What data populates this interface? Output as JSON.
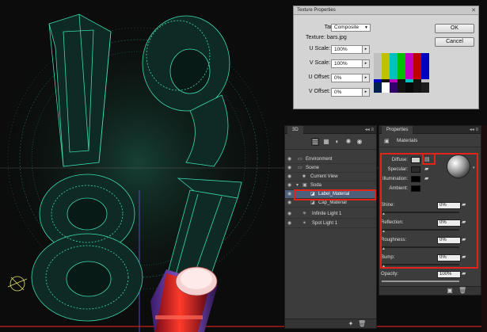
{
  "texture_dialog": {
    "title": "Texture Properties",
    "target_label": "Target:",
    "target_value": "Composite",
    "texture_label": "Texture: bars.jpg",
    "u_scale_label": "U Scale:",
    "u_scale_value": "100%",
    "v_scale_label": "V Scale:",
    "v_scale_value": "100%",
    "u_offset_label": "U Offset:",
    "u_offset_value": "0%",
    "v_offset_label": "V Offset:",
    "v_offset_value": "0%",
    "ok_label": "OK",
    "cancel_label": "Cancel",
    "bar_colors_top": [
      "#c0c0c0",
      "#c0c000",
      "#00c0c0",
      "#00c000",
      "#c000c0",
      "#c00000",
      "#0000c0"
    ],
    "bar_colors_mid": [
      "#0000c0",
      "#131313",
      "#c000c0",
      "#131313",
      "#00c0c0",
      "#131313",
      "#c0c0c0"
    ],
    "bar_colors_bottom": [
      "#00214c",
      "#ffffff",
      "#32006a",
      "#131313",
      "#090909",
      "#131313",
      "#1d1d1d"
    ]
  },
  "panel_3d": {
    "tab": "3D",
    "layers": [
      {
        "label": "Environment"
      },
      {
        "label": "Scene"
      },
      {
        "label": "Current View"
      },
      {
        "label": "Soda"
      },
      {
        "label": "Label_Material"
      },
      {
        "label": "Cap_Material"
      },
      {
        "label": "Infinite Light 1"
      },
      {
        "label": "Spot Light 1"
      }
    ]
  },
  "panel_props": {
    "tab": "Properties",
    "section": "Materials",
    "diffuse_label": "Diffuse:",
    "specular_label": "Specular:",
    "illumination_label": "Illumination:",
    "ambient_label": "Ambient:",
    "shine_label": "Shine:",
    "shine_value": "0%",
    "reflection_label": "Reflection:",
    "reflection_value": "0%",
    "roughness_label": "Roughness:",
    "roughness_value": "0%",
    "bump_label": "Bump:",
    "bump_value": "0%",
    "opacity_label": "Opacity:",
    "opacity_value": "100%",
    "diffuse_color": "#cfcfcf",
    "specular_color": "#2a2a2a",
    "illumination_color": "#000000",
    "ambient_color": "#000000"
  },
  "colors": {
    "wireframe": "#3fd9b0",
    "highlight": "#e2231a",
    "selection": "#4e5f7a"
  }
}
